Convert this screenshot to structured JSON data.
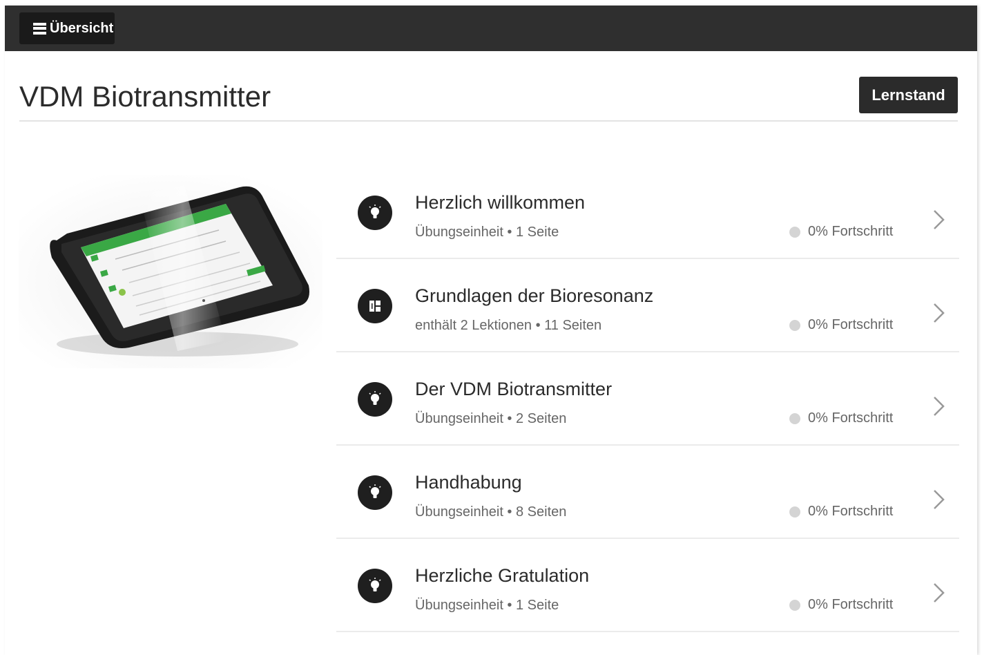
{
  "topbar": {
    "menu_label": "Übersicht",
    "menu_icon": "hamburger-menu-icon"
  },
  "header": {
    "title": "VDM Biotransmitter",
    "lernstand_label": "Lernstand"
  },
  "lessons": [
    {
      "title": "Herzlich willkommen",
      "subtitle": "Übungseinheit • 1 Seite",
      "progress": "0% Fortschritt",
      "icon": "lightbulb-icon"
    },
    {
      "title": "Grundlagen der Bioresonanz",
      "subtitle": "enthält 2 Lektionen • 11 Seiten",
      "progress": "0% Fortschritt",
      "icon": "module-icon"
    },
    {
      "title": "Der VDM Biotransmitter",
      "subtitle": "Übungseinheit • 2 Seiten",
      "progress": "0% Fortschritt",
      "icon": "lightbulb-icon"
    },
    {
      "title": "Handhabung",
      "subtitle": "Übungseinheit • 8 Seiten",
      "progress": "0% Fortschritt",
      "icon": "lightbulb-icon"
    },
    {
      "title": "Herzliche Gratulation",
      "subtitle": "Übungseinheit • 1 Seite",
      "progress": "0% Fortschritt",
      "icon": "lightbulb-icon"
    }
  ],
  "colors": {
    "topbar": "#2f2f2f",
    "button": "#1a1a1a",
    "accent_green": "#3aa845",
    "progress_dot": "#d4d4d4"
  }
}
